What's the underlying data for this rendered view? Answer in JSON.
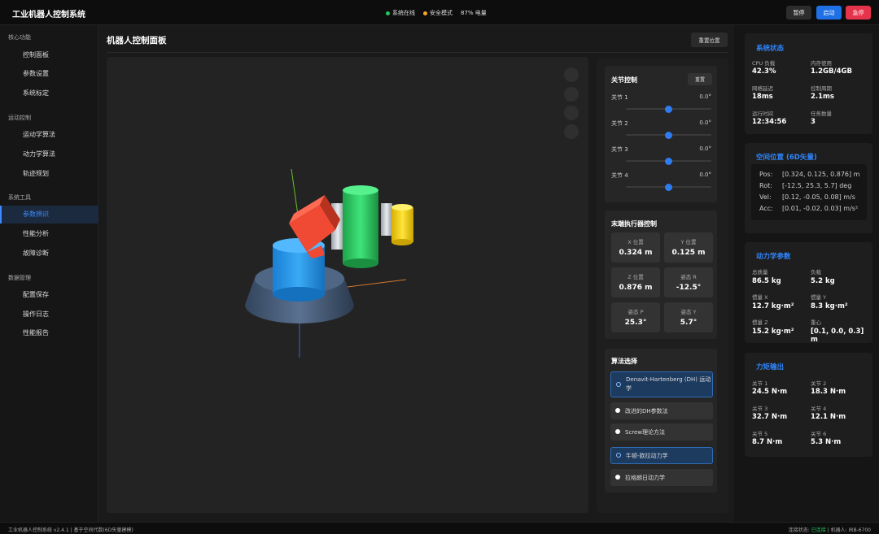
{
  "header": {
    "title": "工业机器人控制系统",
    "status_online": "系统在线",
    "status_safe": "安全模式",
    "battery": "87% 电量",
    "pause_label": "暂停",
    "start_label": "启动",
    "estop_label": "急停",
    "colors": {
      "online": "#22c55e",
      "safe": "#f5a623",
      "start": "#1f6fe5",
      "estop": "#e5334b"
    }
  },
  "sidebar": {
    "sections": [
      {
        "title": "核心功能",
        "items": [
          "控制面板",
          "参数设置",
          "系统标定"
        ]
      },
      {
        "title": "运动控制",
        "items": [
          "运动学算法",
          "动力学算法",
          "轨迹规划"
        ]
      },
      {
        "title": "系统工具",
        "items": [
          "参数辨识",
          "性能分析",
          "故障诊断"
        ]
      },
      {
        "title": "数据管理",
        "items": [
          "配置保存",
          "操作日志",
          "性能报告"
        ]
      }
    ],
    "active_item": "参数辨识"
  },
  "main": {
    "title": "机器人控制面板",
    "reset_position_label": "重置位置"
  },
  "joint_control": {
    "title": "关节控制",
    "reset_label": "重置",
    "joints": [
      {
        "label": "关节 1",
        "value": "0.0°"
      },
      {
        "label": "关节 2",
        "value": "0.0°"
      },
      {
        "label": "关节 3",
        "value": "0.0°"
      },
      {
        "label": "关节 4",
        "value": "0.0°"
      }
    ],
    "slider_fraction": 0.5
  },
  "end_effector": {
    "title": "末端执行器控制",
    "tiles": [
      {
        "label": "X 位置",
        "value": "0.324 m"
      },
      {
        "label": "Y 位置",
        "value": "0.125 m"
      },
      {
        "label": "Z 位置",
        "value": "0.876 m"
      },
      {
        "label": "姿态 R",
        "value": "-12.5°"
      },
      {
        "label": "姿态 P",
        "value": "25.3°"
      },
      {
        "label": "姿态 Y",
        "value": "5.7°"
      }
    ]
  },
  "algorithm": {
    "title": "算法选择",
    "options": [
      {
        "label": "Denavit-Hartenberg (DH) 运动学",
        "selected": true
      },
      {
        "label": "改进的DH参数法",
        "selected": false
      },
      {
        "label": "Screw理论方法",
        "selected": false
      },
      {
        "label": "牛顿-欧拉动力学",
        "selected": true
      },
      {
        "label": "拉格朗日动力学",
        "selected": false
      }
    ]
  },
  "system_status": {
    "title": "系统状态",
    "metrics": [
      {
        "label": "CPU 负载",
        "value": "42.3%"
      },
      {
        "label": "内存使用",
        "value": "1.2GB/4GB"
      },
      {
        "label": "网络延迟",
        "value": "18ms"
      },
      {
        "label": "控制周期",
        "value": "2.1ms"
      },
      {
        "label": "运行时间",
        "value": "12:34:56"
      },
      {
        "label": "任务数量",
        "value": "3"
      }
    ]
  },
  "spatial": {
    "title": "空间位置 (6D矢量)",
    "rows": [
      {
        "key": "Pos:",
        "value": "[0.324, 0.125, 0.876] m"
      },
      {
        "key": "Rot:",
        "value": "[-12.5, 25.3, 5.7] deg"
      },
      {
        "key": "Vel:",
        "value": "[0.12, -0.05, 0.08] m/s"
      },
      {
        "key": "Acc:",
        "value": "[0.01, -0.02, 0.03] m/s²"
      }
    ]
  },
  "dynamics": {
    "title": "动力学参数",
    "metrics": [
      {
        "label": "总质量",
        "value": "86.5 kg"
      },
      {
        "label": "负载",
        "value": "5.2 kg"
      },
      {
        "label": "惯量 X",
        "value": "12.7 kg·m²"
      },
      {
        "label": "惯量 Y",
        "value": "8.3 kg·m²"
      },
      {
        "label": "惯量 Z",
        "value": "15.2 kg·m²"
      },
      {
        "label": "重心",
        "value": "[0.1, 0.0, 0.3] m"
      }
    ]
  },
  "torque": {
    "title": "力矩输出",
    "metrics": [
      {
        "label": "关节 1",
        "value": "24.5 N·m"
      },
      {
        "label": "关节 2",
        "value": "18.3 N·m"
      },
      {
        "label": "关节 3",
        "value": "32.7 N·m"
      },
      {
        "label": "关节 4",
        "value": "12.1 N·m"
      },
      {
        "label": "关节 5",
        "value": "8.7 N·m"
      },
      {
        "label": "关节 6",
        "value": "5.3 N·m"
      }
    ]
  },
  "footer": {
    "left": "工业机器人控制系统 v2.4.1 | 基于空间代数(6D矢量建模)",
    "conn_label": "连接状态: ",
    "conn_value": "已连接",
    "robot": " | 机器人: IRB-6700"
  }
}
